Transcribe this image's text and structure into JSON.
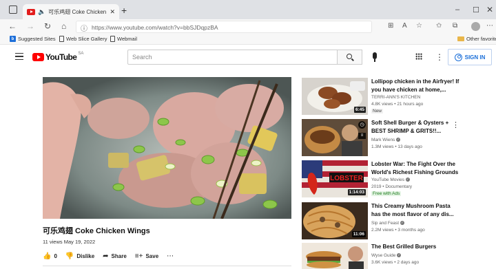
{
  "browser": {
    "tab_title": "可乐鸡翅 Coke Chicken Win",
    "url": "https://www.youtube.com/watch?v=bbSJDqpzBA",
    "favorites": [
      {
        "label": "Suggested Sites"
      },
      {
        "label": "Web Slice Gallery"
      },
      {
        "label": "Webmail"
      }
    ],
    "other_favorites": "Other favorites"
  },
  "youtube": {
    "region_code": "SA",
    "search_placeholder": "Search",
    "sign_in": "SIGN IN"
  },
  "video": {
    "title": "可乐鸡翅 Coke Chicken Wings",
    "views": "11 views",
    "date": "May 19, 2022",
    "likes": "0",
    "dislike_label": "Dislike",
    "share_label": "Share",
    "save_label": "Save"
  },
  "recommendations": [
    {
      "title": "Lollipop chicken in the Airfryer! If you have chicken at home,...",
      "channel": "TERRI-ANN'S KITCHEN",
      "meta": "4.8K views • 21 hours ago",
      "badge": "New",
      "duration": "6:45",
      "verified": false
    },
    {
      "title": "Soft Shell Burger & Oysters + BEST SHRIMP & GRITS!!...",
      "channel": "Mark Wiens",
      "meta": "1.3M views • 13 days ago",
      "verified": true
    },
    {
      "title": "Lobster War: The Fight Over the World's Richest Fishing Grounds",
      "channel": "YouTube Movies",
      "meta": "2019 • Documentary",
      "badge": "Free with Ads",
      "duration": "1:14:03",
      "thumb_text": "LOBSTER",
      "verified": true
    },
    {
      "title": "This Creamy Mushroom Pasta has the most flavor of any dis...",
      "channel": "Sip and Feast",
      "meta": "2.2M views • 3 months ago",
      "duration": "11:06",
      "verified": true
    },
    {
      "title": "The Best Grilled Burgers",
      "channel": "Wyse Guide",
      "meta": "3.6K views • 2 days ago",
      "verified": true
    }
  ]
}
